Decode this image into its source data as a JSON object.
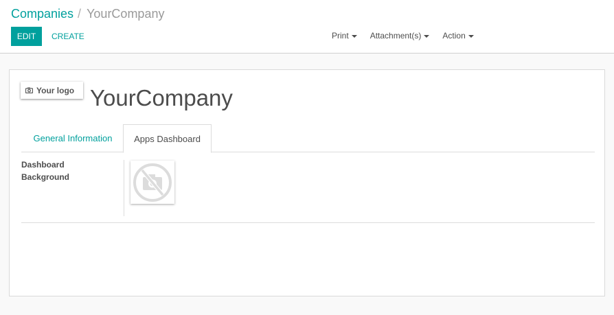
{
  "breadcrumb": {
    "parent": "Companies",
    "separator": "/",
    "current": "YourCompany"
  },
  "toolbar": {
    "edit_label": "EDIT",
    "create_label": "CREATE",
    "menus": [
      "Print",
      "Attachment(s)",
      "Action"
    ]
  },
  "form": {
    "logo_label": "Your logo",
    "logo_icon": "camera-icon",
    "company_name": "YourCompany",
    "tabs": [
      "General Information",
      "Apps Dashboard"
    ],
    "active_tab": "Apps Dashboard",
    "field_label_line1": "Dashboard",
    "field_label_line2": "Background",
    "image_placeholder_icon": "no-camera-icon"
  },
  "colors": {
    "accent": "#00a09d",
    "text": "#4c4c4c",
    "background": "#f9f9f9"
  }
}
